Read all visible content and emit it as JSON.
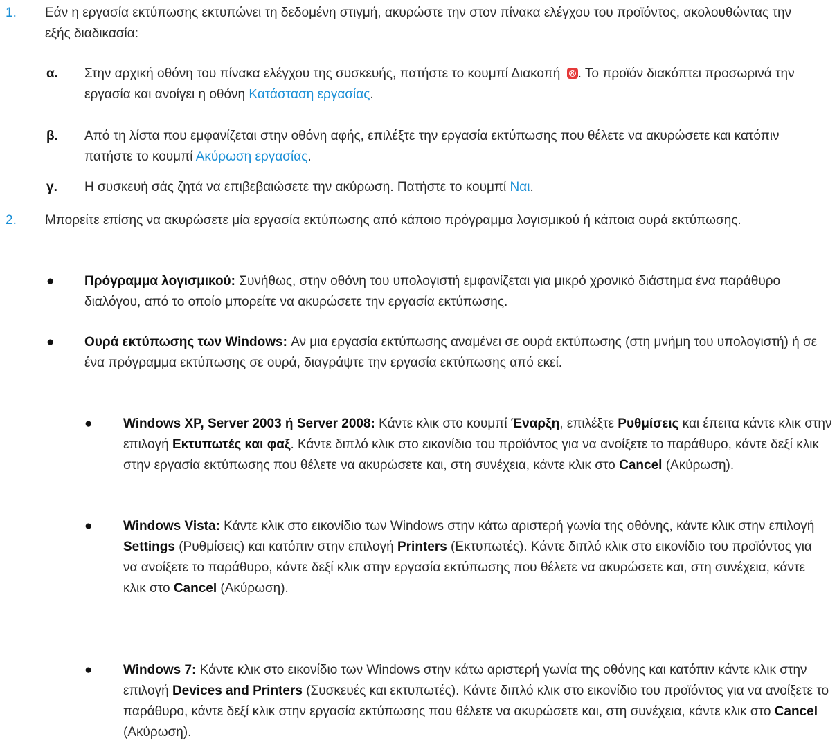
{
  "items": {
    "s1": {
      "num": "1.",
      "text": "Εάν η εργασία εκτύπωσης εκτυπώνει τη δεδομένη στιγμή, ακυρώστε την στον πίνακα ελέγχου του προϊόντος, ακολουθώντας την εξής διαδικασία:"
    },
    "a": {
      "label": "α.",
      "t1": "Στην αρχική οθόνη του πίνακα ελέγχου της συσκευής, πατήστε το κουμπί Διακοπή ",
      "icon": "stop-cancel-icon",
      "t2": ". Το προϊόν διακόπτει προσωρινά την εργασία και ανοίγει η οθόνη ",
      "link": "Κατάσταση εργασίας",
      "t3": "."
    },
    "b": {
      "label": "β.",
      "t1": "Από τη λίστα που εμφανίζεται στην οθόνη αφής, επιλέξτε την εργασία εκτύπωσης που θέλετε να ακυρώσετε και κατόπιν πατήστε το κουμπί ",
      "link": "Ακύρωση εργασίας",
      "t2": "."
    },
    "c": {
      "label": "γ.",
      "t1": "Η συσκευή σάς ζητά να επιβεβαιώσετε την ακύρωση. Πατήστε το κουμπί ",
      "link": "Ναι",
      "t2": "."
    },
    "s2": {
      "num": "2.",
      "text": "Μπορείτε επίσης να ακυρώσετε μία εργασία εκτύπωσης από κάποιο πρόγραμμα λογισμικού ή κάποια ουρά εκτύπωσης."
    },
    "bul1": {
      "bullet": "●",
      "bold": "Πρόγραμμα λογισμικού:",
      "text": " Συνήθως, στην οθόνη του υπολογιστή εμφανίζεται για μικρό χρονικό διάστημα ένα παράθυρο διαλόγου, από το οποίο μπορείτε να ακυρώσετε την εργασία εκτύπωσης."
    },
    "bul2": {
      "bullet": "●",
      "bold": "Ουρά εκτύπωσης των Windows:",
      "text": " Αν μια εργασία εκτύπωσης αναμένει σε ουρά εκτύπωσης (στη μνήμη του υπολογιστή) ή σε ένα πρόγραμμα εκτύπωσης σε ουρά, διαγράψτε την εργασία εκτύπωσης από εκεί."
    },
    "xp": {
      "bullet": "●",
      "b1": "Windows XP, Server 2003 ή Server 2008:",
      "t1": " Κάντε κλικ στο κουμπί ",
      "b2": "Έναρξη",
      "t2": ", επιλέξτε ",
      "b3": "Ρυθμίσεις",
      "t3": " και έπειτα κάντε κλικ στην επιλογή ",
      "b4": "Εκτυπωτές και φαξ",
      "t4": ". Κάντε διπλό κλικ στο εικονίδιο του προϊόντος για να ανοίξετε το παράθυρο, κάντε δεξί κλικ στην εργασία εκτύπωσης που θέλετε να ακυρώσετε και, στη συνέχεια, κάντε κλικ στο ",
      "b5": "Cancel",
      "t5": " (Ακύρωση)."
    },
    "vista": {
      "bullet": "●",
      "b1": "Windows Vista:",
      "t1": " Κάντε κλικ στο εικονίδιο των Windows στην κάτω αριστερή γωνία της οθόνης, κάντε κλικ στην επιλογή ",
      "b2": "Settings",
      "t2": " (Ρυθμίσεις) και κατόπιν στην επιλογή ",
      "b3": "Printers",
      "t3": " (Εκτυπωτές). Κάντε διπλό κλικ στο εικονίδιο του προϊόντος για να ανοίξετε το παράθυρο, κάντε δεξί κλικ στην εργασία εκτύπωσης που θέλετε να ακυρώσετε και, στη συνέχεια, κάντε κλικ στο ",
      "b4": "Cancel",
      "t4": " (Ακύρωση)."
    },
    "w7": {
      "bullet": "●",
      "b1": "Windows 7:",
      "t1": " Κάντε κλικ στο εικονίδιο των Windows στην κάτω αριστερή γωνία της οθόνης και κατόπιν κάντε κλικ στην επιλογή ",
      "b2": "Devices and Printers",
      "t2": " (Συσκευές και εκτυπωτές). Κάντε διπλό κλικ στο εικονίδιο του προϊόντος για να ανοίξετε το παράθυρο, κάντε δεξί κλικ στην εργασία εκτύπωσης που θέλετε να ακυρώσετε και, στη συνέχεια, κάντε κλικ στο ",
      "b3": "Cancel",
      "t3": " (Ακύρωση)."
    }
  }
}
